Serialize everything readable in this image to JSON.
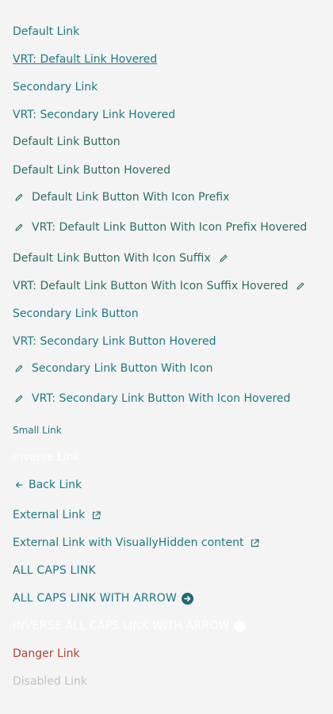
{
  "links": {
    "default": "Default Link",
    "default_hovered": "VRT: Default Link Hovered",
    "secondary": "Secondary Link",
    "secondary_hovered": "VRT: Secondary Link Hovered",
    "default_button": "Default Link Button",
    "default_button_hovered": "Default Link Button Hovered",
    "default_button_icon_prefix": "Default Link Button With Icon Prefix",
    "default_button_icon_prefix_hovered": "VRT: Default Link Button With Icon Prefix Hovered",
    "default_button_icon_suffix": "Default Link Button With Icon Suffix",
    "default_button_icon_suffix_hovered": "VRT: Default Link Button With Icon Suffix Hovered",
    "secondary_button": "Secondary Link Button",
    "secondary_button_hovered": "VRT: Secondary Link Button Hovered",
    "secondary_button_icon": "Secondary Link Button With Icon",
    "secondary_button_icon_hovered": "VRT: Secondary Link Button With Icon Hovered",
    "small": "Small Link",
    "inverse": "Inverse Link",
    "back": "Back Link",
    "external": "External Link",
    "external_hidden": "External Link with VisuallyHidden content",
    "all_caps": "ALL CAPS LINK",
    "all_caps_arrow": "ALL CAPS LINK WITH ARROW",
    "inverse_all_caps_arrow": "INVERSE ALL CAPS LINK WITH ARROW",
    "danger": "Danger Link",
    "disabled": "Disabled Link"
  },
  "icons": {
    "pencil": "pencil-icon",
    "back_arrow": "arrow-left-icon",
    "external": "external-link-icon",
    "arrow_circle": "arrow-circle-right-icon"
  },
  "colors": {
    "background": "#f4f4f4",
    "link": "#1f7a82",
    "link_button": "#2b6f62",
    "inverse": "#ffffff",
    "danger": "#b0432b",
    "disabled": "#c2c2c2"
  }
}
